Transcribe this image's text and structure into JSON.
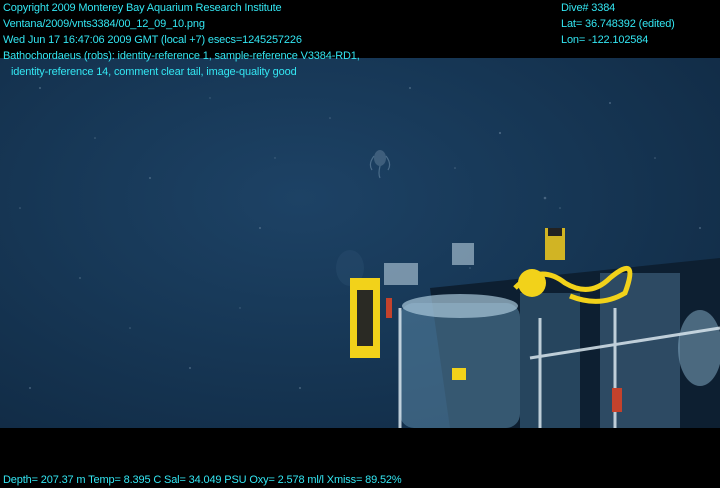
{
  "header": {
    "copyright": "Copyright 2009 Monterey Bay Aquarium Research Institute",
    "file_path": "Ventana/2009/vnts3384/00_12_09_10.png",
    "datetime": "Wed Jun 17 16:47:06 2009 GMT (local +7)  esecs=1245257226",
    "annotation_line1": "Bathochordaeus (robs): identity-reference 1, sample-reference V3384-RD1,",
    "annotation_line2": "identity-reference 14, comment clear tail, image-quality good"
  },
  "dive_info": {
    "dive": "Dive# 3384",
    "latitude": "Lat= 36.748392 (edited)",
    "longitude": "Lon= -122.102584"
  },
  "sensors": {
    "readout": "Depth= 207.37 m  Temp= 8.395 C  Sal= 34.049 PSU  Oxy= 2.578 ml/l  Xmiss= 89.52%"
  },
  "colors": {
    "overlay_text": "#33e6f2",
    "water": "#173857",
    "equipment_yellow": "#f2d21a"
  }
}
